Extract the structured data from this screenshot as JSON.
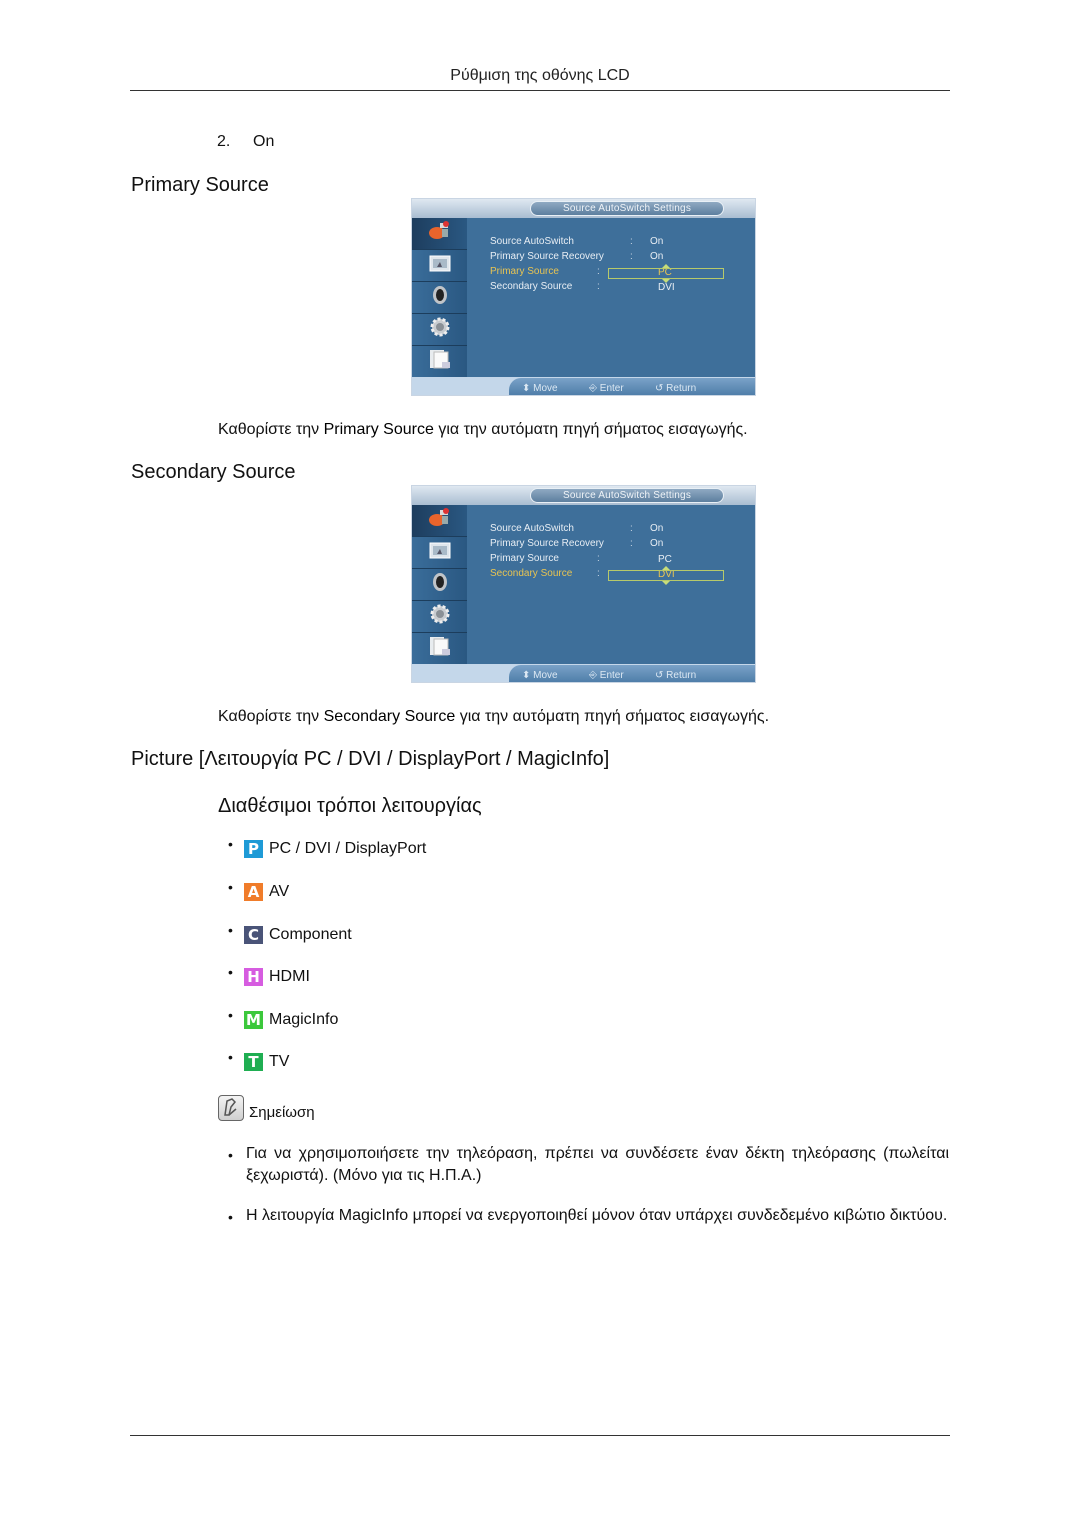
{
  "header": {
    "running_title": "Ρύθμιση της οθόνης LCD"
  },
  "step": {
    "number": "2.",
    "label": "On"
  },
  "sections": {
    "primary": {
      "heading": "Primary Source",
      "desc_pre": "Καθορίστε την ",
      "desc_bold": "Primary Source",
      "desc_post": " για την αυτόματη πηγή σήματος εισαγωγής."
    },
    "secondary": {
      "heading": "Secondary Source",
      "desc_pre": "Καθορίστε την ",
      "desc_bold": "Secondary Source",
      "desc_post": " για την αυτόματη πηγή σήματος εισαγωγής."
    },
    "picture": {
      "heading": "Picture [Λειτουργία PC / DVI / DisplayPort / MagicInfo]",
      "subheading": "Διαθέσιμοι τρόποι λειτουργίας"
    }
  },
  "osd": {
    "title": "Source AutoSwitch Settings",
    "side_icons": [
      "input-icon",
      "picture-icon",
      "sound-icon",
      "setup-icon",
      "multi-control-icon"
    ],
    "rows": [
      {
        "label": "Source AutoSwitch",
        "value": "On"
      },
      {
        "label": "Primary Source Recovery",
        "value": "On"
      },
      {
        "label": "Primary Source",
        "value": "PC"
      },
      {
        "label": "Secondary Source",
        "value": "DVI"
      }
    ],
    "footer": {
      "move": "Move",
      "enter": "Enter",
      "return": "Return"
    },
    "colors": {
      "panel": "#3e6f9a",
      "highlight": "#e8c452",
      "selection_border": "#b7c96a"
    }
  },
  "modes": [
    {
      "letter": "P",
      "label": "PC / DVI / DisplayPort",
      "color": "#1e9ad6"
    },
    {
      "letter": "A",
      "label": "AV",
      "color": "#f07c2a"
    },
    {
      "letter": "C",
      "label": "Component",
      "color": "#4a5478"
    },
    {
      "letter": "H",
      "label": "HDMI",
      "color": "#d65ce0"
    },
    {
      "letter": "M",
      "label": "MagicInfo",
      "color": "#3cc83c"
    },
    {
      "letter": "T",
      "label": "TV",
      "color": "#1fae52"
    }
  ],
  "note": {
    "label": "Σημείωση",
    "items": [
      {
        "pre": "Για να χρησιμοποιήσετε την τηλεόραση, πρέπει να συνδέσετε έναν δέκτη τηλεόρασης (πωλείται ξεχωριστά). (Μόνο για τις Η.Π.Α.)",
        "bold": "",
        "post": ""
      },
      {
        "pre": "Η λειτουργία ",
        "bold": "MagicInfo",
        "post": " μπορεί να ενεργοποιηθεί μόνον όταν υπάρχει συνδεδεμένο κιβώτιο δικτύου."
      }
    ]
  }
}
